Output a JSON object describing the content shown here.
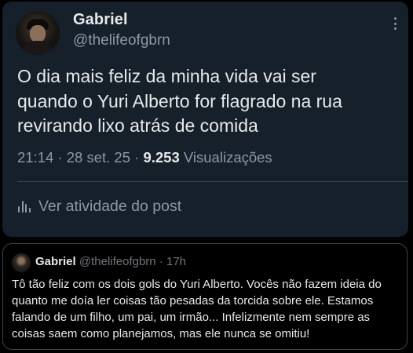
{
  "tweet": {
    "author_name": "Gabriel",
    "author_handle": "@thelifeofgbrn",
    "text": "O dia mais feliz da minha vida vai ser\nquando o Yuri Alberto for flagrado na rua\nrevirando lixo atrás de comida",
    "time": "21:14",
    "separator": "·",
    "date": "28 set. 25",
    "views_count": "9.253",
    "views_label": "Visualizações",
    "activity_label": "Ver atividade do post",
    "avatar_icon": "user-avatar",
    "more_icon": "more-options-icon",
    "activity_icon": "analytics-bars-icon"
  },
  "quoted_tweet": {
    "author_name": "Gabriel",
    "author_handle": "@thelifeofgbrn",
    "separator": "·",
    "age": "17h",
    "text": "Tô tão feliz com os dois gols do Yuri Alberto. Vocês não fazem ideia do quanto me doía ler coisas tão pesadas da torcida sobre ele. Estamos falando de um filho, um pai, um irmão... Infelizmente nem sempre as coisas saem como planejamos, mas ele nunca se omitiu!"
  },
  "colors": {
    "card_background": "#15202b",
    "page_background": "#000000",
    "primary_text": "#e7e9ea",
    "secondary_text": "#8b98a5",
    "divider": "#38444d",
    "quote_border": "#3e4144"
  }
}
